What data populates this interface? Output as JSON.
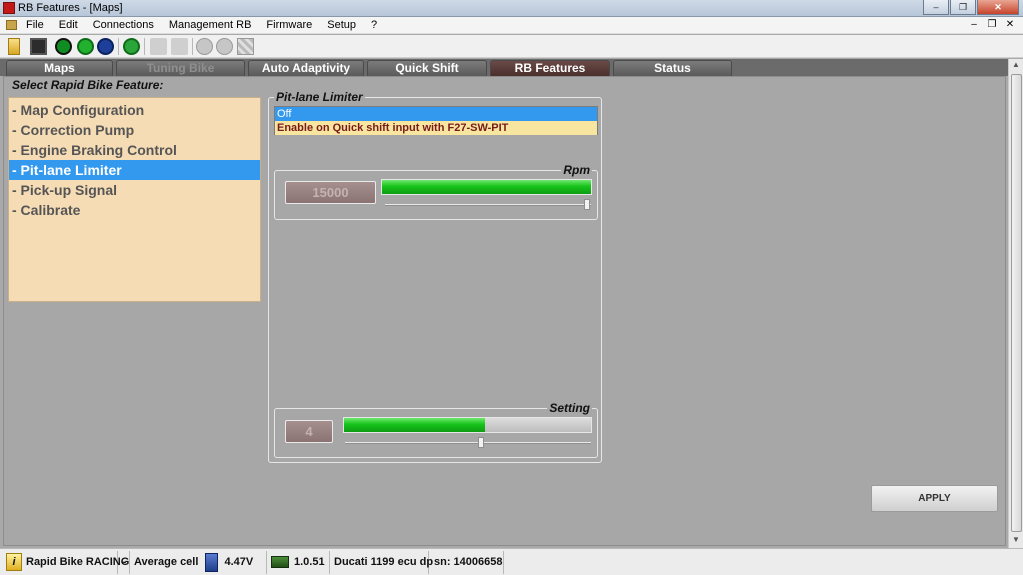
{
  "window": {
    "title": "RB Features - [Maps]"
  },
  "menu": {
    "items": [
      "File",
      "Edit",
      "Connections",
      "Management RB",
      "Firmware",
      "Setup",
      "?"
    ]
  },
  "tabs": [
    {
      "label": "Maps"
    },
    {
      "label": "Tuning Bike"
    },
    {
      "label": "Auto Adaptivity"
    },
    {
      "label": "Quick Shift"
    },
    {
      "label": "RB Features"
    },
    {
      "label": "Status"
    }
  ],
  "feature_list": {
    "heading": "Select Rapid Bike Feature:",
    "items": [
      "- Map Configuration",
      "- Correction Pump",
      "- Engine Braking Control",
      "- Pit-lane Limiter",
      "- Pick-up Signal",
      "- Calibrate"
    ],
    "selected": "- Pit-lane Limiter"
  },
  "pit_lane": {
    "title": "Pit-lane Limiter",
    "options": [
      "Off",
      "Enable on Quick shift input with F27-SW-PIT"
    ],
    "selected": "Off",
    "rpm": {
      "label": "Rpm",
      "value": "15000",
      "level": 1.0
    },
    "setting": {
      "label": "Setting",
      "value": "4",
      "level": 0.57
    }
  },
  "apply_label": "APPLY",
  "status_bar": {
    "product": "Rapid Bike RACING",
    "separator": "-",
    "cell_label": "Average cell",
    "voltage": "4.47V",
    "version": "1.0.51",
    "ecu": "Ducati 1199 ecu dp",
    "serial": "sn: 14006658"
  },
  "colors": {
    "selection": "#3399ee",
    "list_bg": "#f6dcb5",
    "bar_green": "#16c41a",
    "active_tab": "#4a2f2c"
  }
}
